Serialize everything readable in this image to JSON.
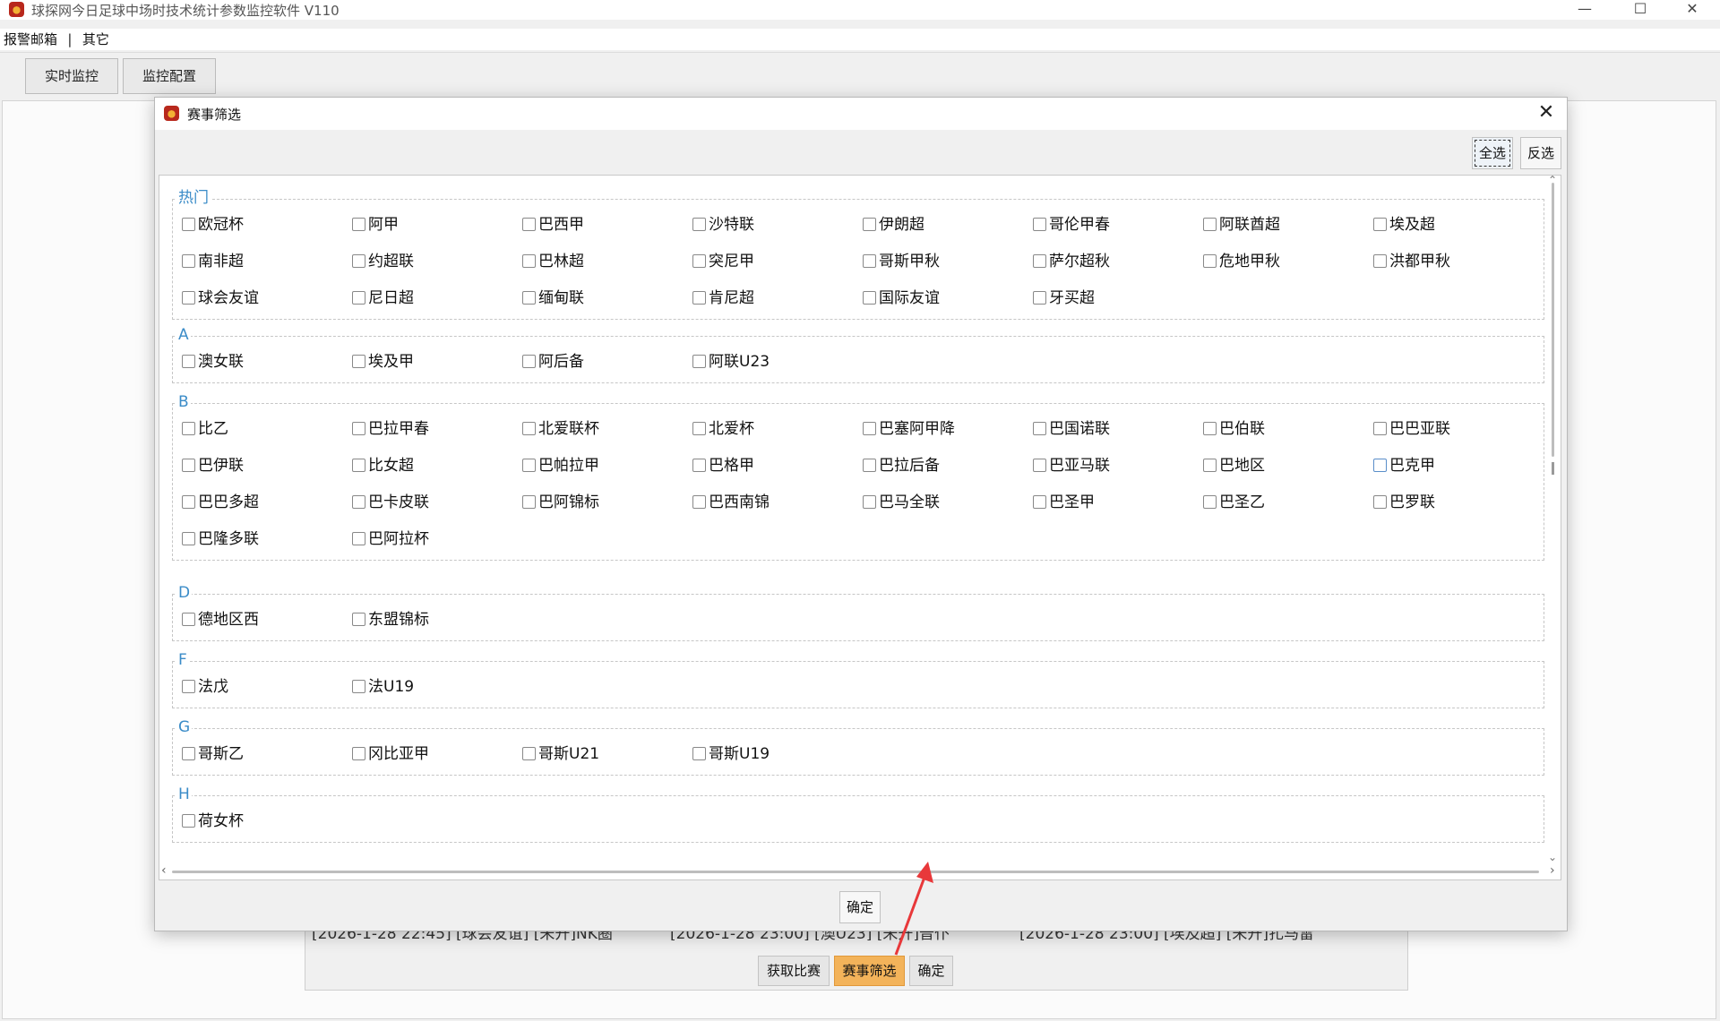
{
  "window": {
    "title": "球探网今日足球中场时技术统计参数监控软件 V110",
    "minimize": "—",
    "maximize": "☐",
    "close": "✕"
  },
  "menu": {
    "items": [
      "报警邮箱",
      "其它"
    ],
    "separator": "|"
  },
  "tabs": [
    {
      "label": "实时监控"
    },
    {
      "label": "监控配置"
    }
  ],
  "background_panel": {
    "list_items": [
      "[2026-1-28 22:45] [球会友谊] [未开]NK圈",
      "[2026-1-28 23:00] [澳U23] [未开]普仆",
      "[2026-1-28 23:00] [埃及超] [未开]扎马雷"
    ],
    "buttons": {
      "fetch": "获取比赛",
      "filter": "赛事筛选",
      "ok": "确定"
    }
  },
  "dialog": {
    "title": "赛事筛选",
    "close": "✕",
    "select_all": "全选",
    "invert": "反选",
    "ok": "确定",
    "groups": [
      {
        "name": "热门",
        "items": [
          "欧冠杯",
          "阿甲",
          "巴西甲",
          "沙特联",
          "伊朗超",
          "哥伦甲春",
          "阿联酋超",
          "埃及超",
          "南非超",
          "约超联",
          "巴林超",
          "突尼甲",
          "哥斯甲秋",
          "萨尔超秋",
          "危地甲秋",
          "洪都甲秋",
          "球会友谊",
          "尼日超",
          "缅甸联",
          "肯尼超",
          "国际友谊",
          "牙买超"
        ]
      },
      {
        "name": "A",
        "items": [
          "澳女联",
          "埃及甲",
          "阿后备",
          "阿联U23"
        ]
      },
      {
        "name": "B",
        "items": [
          "比乙",
          "巴拉甲春",
          "北爱联杯",
          "北爱杯",
          "巴塞阿甲降",
          "巴国诺联",
          "巴伯联",
          "巴巴亚联",
          "巴伊联",
          "比女超",
          "巴帕拉甲",
          "巴格甲",
          "巴拉后备",
          "巴亚马联",
          "巴地区",
          "巴克甲",
          "巴巴多超",
          "巴卡皮联",
          "巴阿锦标",
          "巴西南锦",
          "巴马全联",
          "巴圣甲",
          "巴圣乙",
          "巴罗联",
          "巴隆多联",
          "巴阿拉杯"
        ]
      },
      {
        "name": "D",
        "items": [
          "德地区西",
          "东盟锦标"
        ]
      },
      {
        "name": "F",
        "items": [
          "法戊",
          "法U19"
        ]
      },
      {
        "name": "G",
        "items": [
          "哥斯乙",
          "冈比亚甲",
          "哥斯U21",
          "哥斯U19"
        ]
      },
      {
        "name": "H",
        "items": [
          "荷女杯"
        ]
      }
    ],
    "hover_item": "巴克甲"
  },
  "colors": {
    "legend": "#3b8cc8",
    "active_button": "#f3b35a",
    "arrow": "#e8383a"
  }
}
